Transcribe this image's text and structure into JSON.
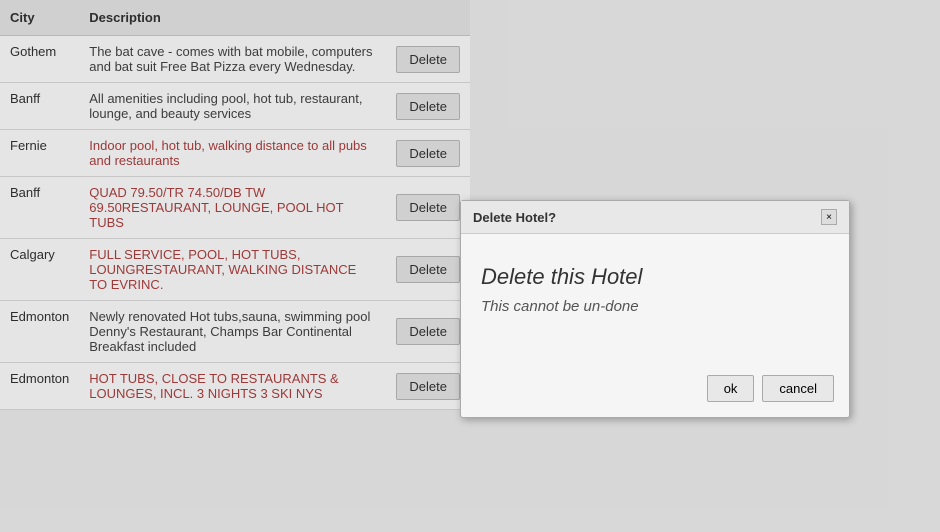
{
  "table": {
    "columns": {
      "city": "City",
      "description": "Description",
      "action": ""
    },
    "rows": [
      {
        "city": "Gothem",
        "description": "The bat cave - comes with bat mobile, computers and bat suit Free Bat Pizza every Wednesday.",
        "descStyle": "dark",
        "action": "Delete"
      },
      {
        "city": "Banff",
        "description": "All amenities including pool, hot tub, restaurant, lounge, and beauty services",
        "descStyle": "dark",
        "action": "Delete"
      },
      {
        "city": "Fernie",
        "description": "Indoor pool, hot tub, walking distance to all pubs and restaurants",
        "descStyle": "red",
        "action": "Delete"
      },
      {
        "city": "Banff",
        "description": "QUAD 79.50/TR 74.50/DB TW 69.50RESTAURANT, LOUNGE, POOL HOT TUBS",
        "descStyle": "red",
        "action": "Delete"
      },
      {
        "city": "Calgary",
        "description": "FULL SERVICE, POOL, HOT TUBS, LOUNGRESTAURANT, WALKING DISTANCE TO EVRINC.",
        "descStyle": "red",
        "action": "Delete"
      },
      {
        "city": "Edmonton",
        "description": "Newly renovated Hot tubs,sauna, swimming pool Denny's Restaurant, Champs Bar Continental Breakfast included",
        "descStyle": "dark",
        "action": "Delete"
      },
      {
        "city": "Edmonton",
        "description": "HOT TUBS, CLOSE TO RESTAURANTS & LOUNGES, INCL. 3 NIGHTS 3 SKI NYS",
        "descStyle": "red",
        "action": "Delete"
      }
    ]
  },
  "modal": {
    "title": "Delete Hotel?",
    "main_text": "Delete this Hotel",
    "sub_text": "This cannot be un-done",
    "ok_label": "ok",
    "cancel_label": "cancel"
  }
}
